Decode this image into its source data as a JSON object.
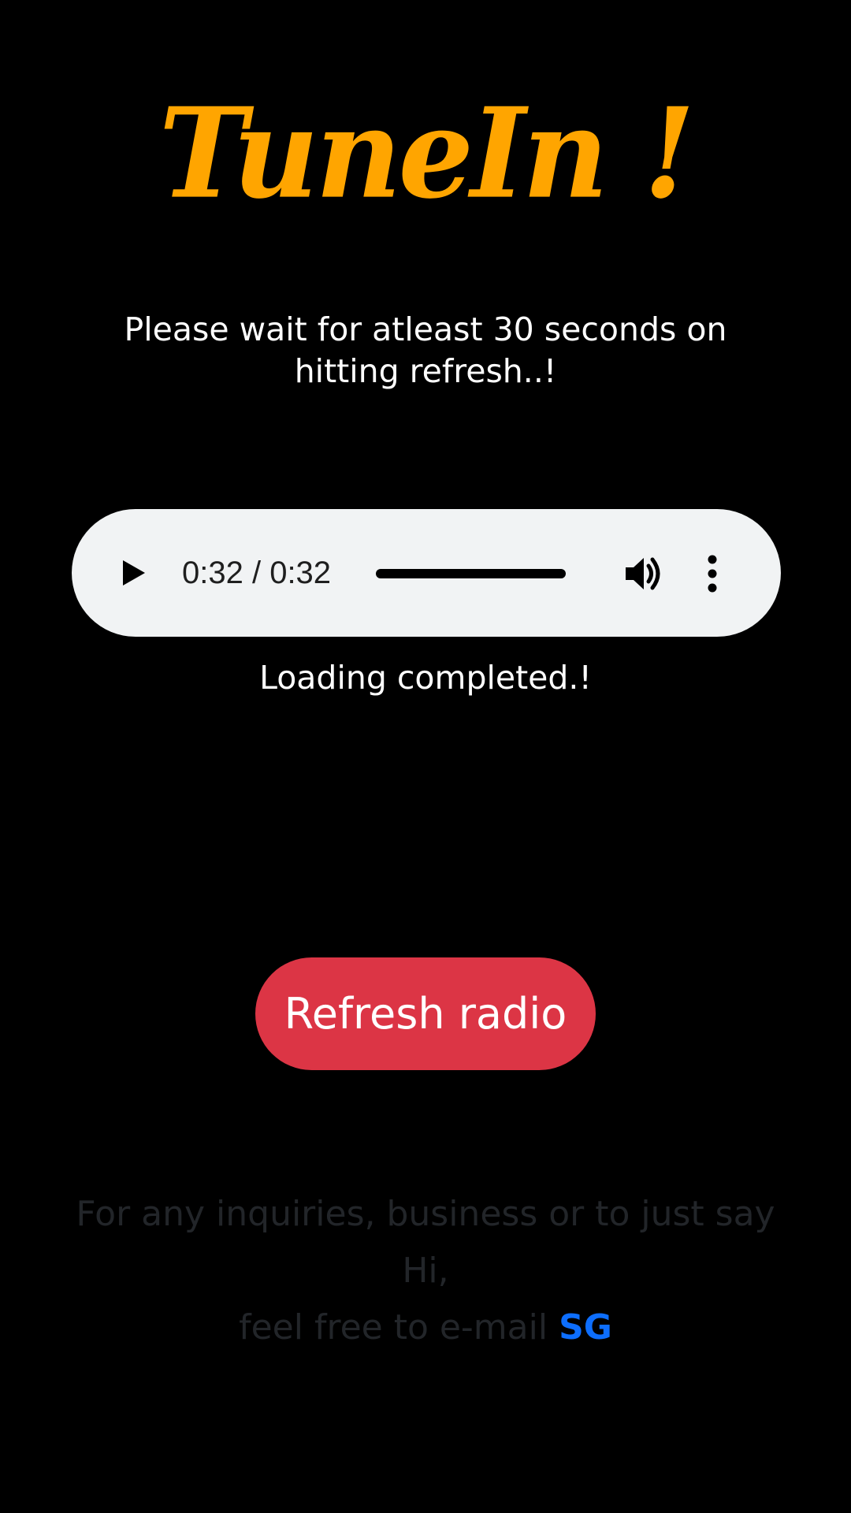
{
  "app": {
    "title": "TuneIn !"
  },
  "notice": {
    "text": "Please wait for atleast 30 seconds on hitting refresh..!"
  },
  "player": {
    "time": "0:32 / 0:32",
    "progress": 1.0,
    "icons": {
      "play": "play-icon",
      "volume": "volume-icon",
      "more": "more-options-icon"
    }
  },
  "status": {
    "text": "Loading completed.!"
  },
  "actions": {
    "refresh_label": "Refresh radio"
  },
  "footer": {
    "line1": "For any inquiries, business or to just say Hi,",
    "line2_prefix": "feel free to e-mail ",
    "email_link": "SG"
  },
  "colors": {
    "background": "#000000",
    "logo": "#ffa500",
    "refresh_button": "#dc3545",
    "link": "#0d6efd",
    "player_bg": "#f1f3f4"
  }
}
